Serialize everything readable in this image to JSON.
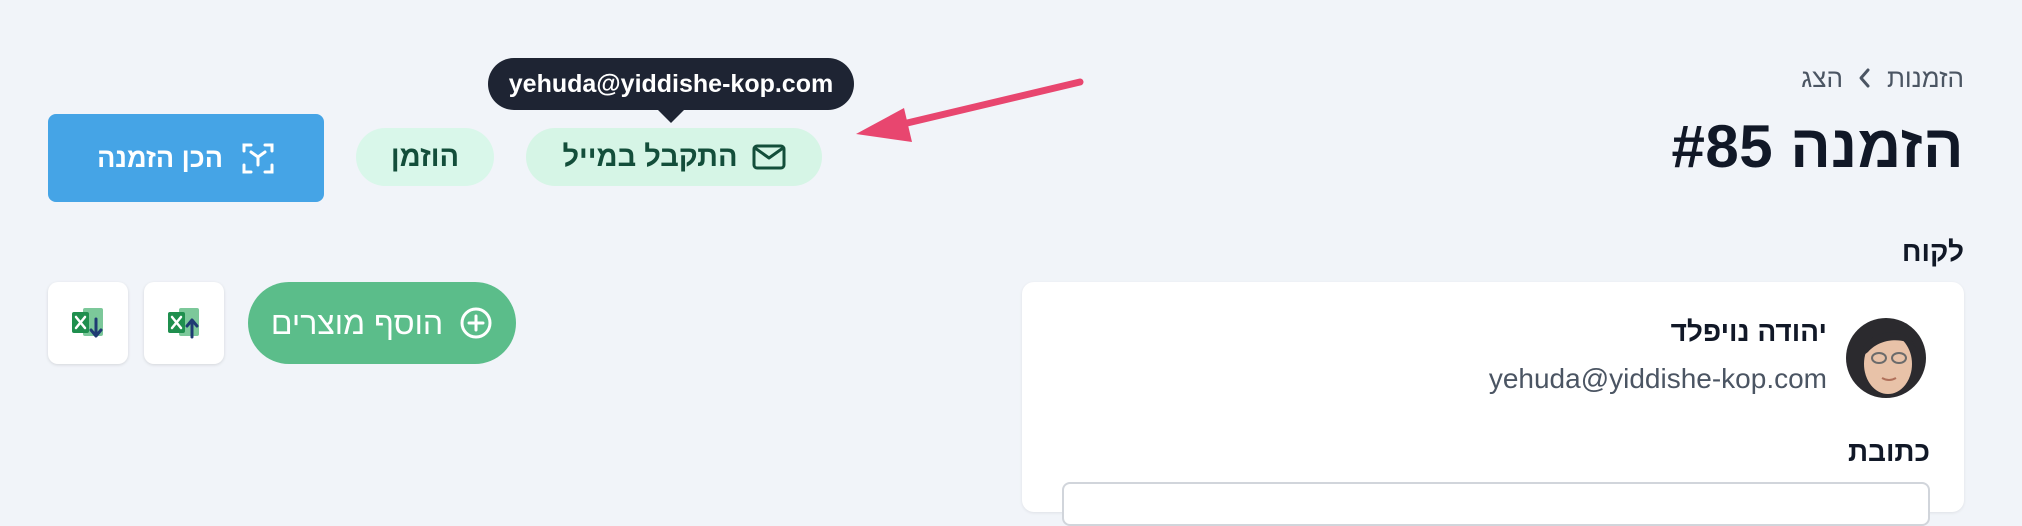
{
  "breadcrumb": {
    "items": [
      "הזמנות",
      "הצג"
    ]
  },
  "page": {
    "title": "הזמנה #85"
  },
  "status": {
    "email_badge": "התקבל במייל",
    "ordered_badge": "הוזמן",
    "tooltip": "yehuda@yiddishe-kop.com"
  },
  "actions": {
    "prepare_order": "הכן הזמנה",
    "add_products": "הוסף מוצרים"
  },
  "customer": {
    "section_label": "לקוח",
    "name": "יהודה נויפלד",
    "email": "yehuda@yiddishe-kop.com",
    "address_label": "כתובת"
  },
  "colors": {
    "primary": "#45a4e6",
    "success": "#5bbd8a",
    "badge_bg": "#d6f5e6",
    "tooltip_bg": "#1e2433",
    "annotation": "#e8466f"
  },
  "icons": {
    "email_badge": "envelope-icon",
    "prepare_order": "scan-icon",
    "add_products": "plus-circle-icon",
    "excel_import": "excel-import-icon",
    "excel_export": "excel-export-icon"
  }
}
